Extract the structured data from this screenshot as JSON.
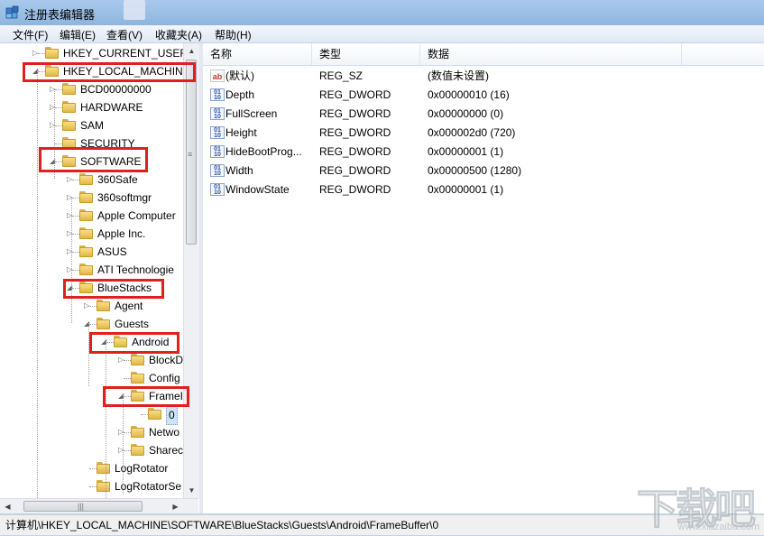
{
  "window": {
    "title": "注册表编辑器"
  },
  "menu": [
    "文件(F)",
    "编辑(E)",
    "查看(V)",
    "收藏夹(A)",
    "帮助(H)"
  ],
  "tree": [
    {
      "label": "HKEY_CURRENT_USER",
      "level": 0,
      "arrow": "collapsed"
    },
    {
      "label": "HKEY_LOCAL_MACHINE",
      "level": 0,
      "arrow": "expanded"
    },
    {
      "label": "BCD00000000",
      "level": 1,
      "arrow": "collapsed"
    },
    {
      "label": "HARDWARE",
      "level": 1,
      "arrow": "collapsed"
    },
    {
      "label": "SAM",
      "level": 1,
      "arrow": "collapsed"
    },
    {
      "label": "SECURITY",
      "level": 1,
      "arrow": "none"
    },
    {
      "label": "SOFTWARE",
      "level": 1,
      "arrow": "expanded"
    },
    {
      "label": "360Safe",
      "level": 2,
      "arrow": "collapsed"
    },
    {
      "label": "360softmgr",
      "level": 2,
      "arrow": "collapsed"
    },
    {
      "label": "Apple Computer",
      "level": 2,
      "arrow": "collapsed"
    },
    {
      "label": "Apple Inc.",
      "level": 2,
      "arrow": "collapsed"
    },
    {
      "label": "ASUS",
      "level": 2,
      "arrow": "collapsed"
    },
    {
      "label": "ATI Technologie",
      "level": 2,
      "arrow": "collapsed"
    },
    {
      "label": "BlueStacks",
      "level": 2,
      "arrow": "expanded"
    },
    {
      "label": "Agent",
      "level": 3,
      "arrow": "collapsed"
    },
    {
      "label": "Guests",
      "level": 3,
      "arrow": "expanded"
    },
    {
      "label": "Android",
      "level": 4,
      "arrow": "expanded"
    },
    {
      "label": "BlockD",
      "level": 5,
      "arrow": "collapsed"
    },
    {
      "label": "Config",
      "level": 5,
      "arrow": "none"
    },
    {
      "label": "FrameI",
      "level": 5,
      "arrow": "expanded"
    },
    {
      "label": "0",
      "level": 6,
      "arrow": "none",
      "selected": true
    },
    {
      "label": "Netwo",
      "level": 5,
      "arrow": "collapsed"
    },
    {
      "label": "Sharec",
      "level": 5,
      "arrow": "collapsed"
    },
    {
      "label": "LogRotator",
      "level": 3,
      "arrow": "none"
    },
    {
      "label": "LogRotatorSe",
      "level": 3,
      "arrow": "none"
    }
  ],
  "list": {
    "columns": [
      "名称",
      "类型",
      "数据"
    ],
    "rows": [
      {
        "icon": "string-value-icon",
        "name": "(默认)",
        "type": "REG_SZ",
        "data": "(数值未设置)"
      },
      {
        "icon": "dword-value-icon",
        "name": "Depth",
        "type": "REG_DWORD",
        "data": "0x00000010 (16)"
      },
      {
        "icon": "dword-value-icon",
        "name": "FullScreen",
        "type": "REG_DWORD",
        "data": "0x00000000 (0)"
      },
      {
        "icon": "dword-value-icon",
        "name": "Height",
        "type": "REG_DWORD",
        "data": "0x000002d0 (720)"
      },
      {
        "icon": "dword-value-icon",
        "name": "HideBootProg...",
        "type": "REG_DWORD",
        "data": "0x00000001 (1)"
      },
      {
        "icon": "dword-value-icon",
        "name": "Width",
        "type": "REG_DWORD",
        "data": "0x00000500 (1280)"
      },
      {
        "icon": "dword-value-icon",
        "name": "WindowState",
        "type": "REG_DWORD",
        "data": "0x00000001 (1)"
      }
    ]
  },
  "status": {
    "path": "计算机\\HKEY_LOCAL_MACHINE\\SOFTWARE\\BlueStacks\\Guests\\Android\\FrameBuffer\\0"
  },
  "watermark": {
    "logo": "下载吧",
    "url": "www.xiazaiba.com"
  },
  "colors": {
    "highlight_box": "#e0201e",
    "selection": "#cde4f7",
    "titlebar": "#a9c9ec"
  }
}
